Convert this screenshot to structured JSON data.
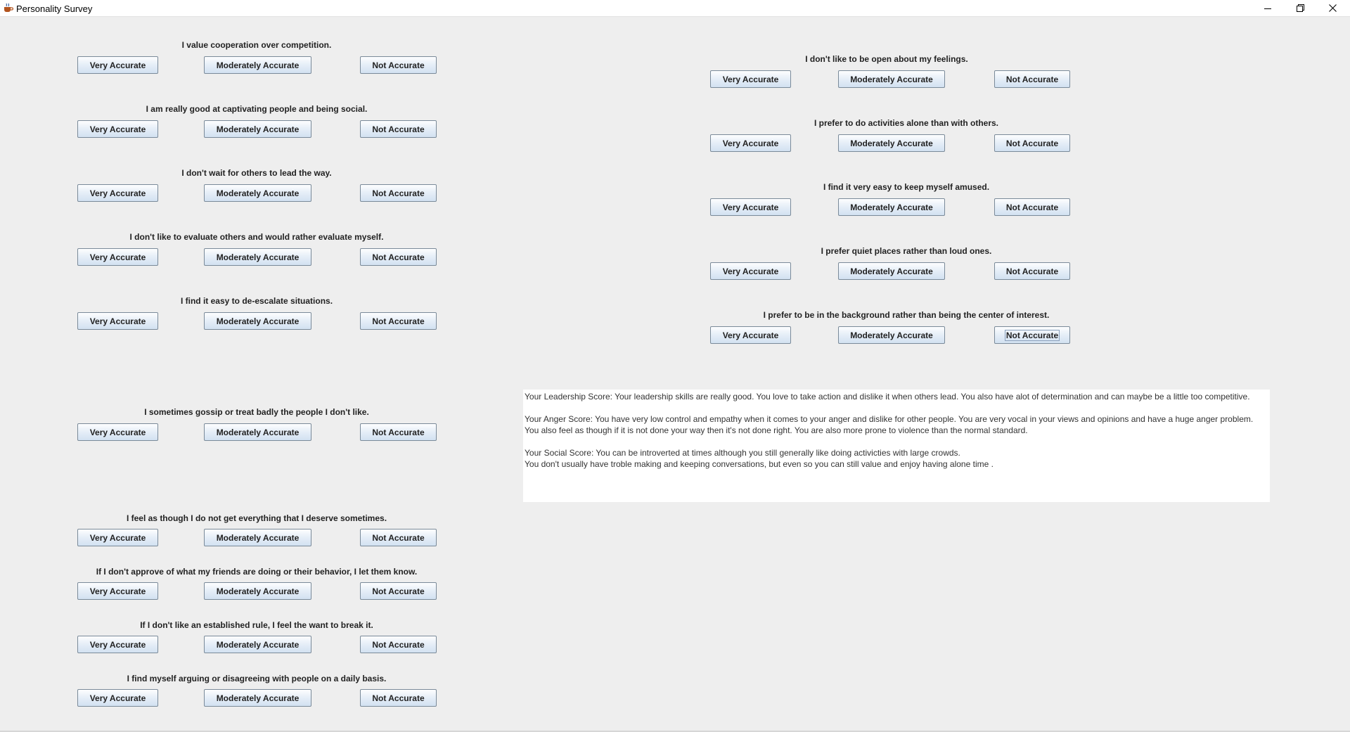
{
  "window": {
    "title": "Personality Survey",
    "icons": {
      "app": "java-cup-icon",
      "minimize": "minimize-icon",
      "restore": "restore-icon",
      "close": "close-icon"
    }
  },
  "answers": {
    "very": "Very Accurate",
    "moderate": "Moderately Accurate",
    "not": "Not Accurate"
  },
  "left_questions": [
    "I value cooperation over competition.",
    "I am really good at captivating people and being social.",
    "I don't wait for others to lead the way.",
    "I don't like to evaluate others and would rather evaluate myself.",
    "I find it easy to de-escalate situations.",
    "I sometimes gossip or treat badly the people I don't like.",
    "I feel as though I do not get everything that I deserve sometimes.",
    "If I don't approve of what my friends are doing or their behavior, I let them know.",
    "If I don't like an established rule, I feel the want to break it.",
    "I find myself arguing or disagreeing with people on a daily basis."
  ],
  "right_questions": [
    "I don't like to be open about my feelings.",
    "I prefer to do activities alone than with others.",
    "I find it very easy to keep myself amused.",
    "I prefer quiet places rather than loud ones.",
    "I prefer to be in the background rather than being the center of interest."
  ],
  "results": {
    "leadership": "Your Leadership Score: Your leadership skills are really good. You love to take action and dislike it when others lead. You also have alot of determination and can maybe be a little too competitive.",
    "anger_1": "Your Anger Score:  You have very low control and empathy when it comes to your anger and dislike for other people. You are very vocal in your views and opinions and have a huge anger problem.",
    "anger_2": "You also feel as though if it is not done your way then it's not done right. You are also more prone to violence than the normal standard.",
    "social_1": "Your Social Score: You can be introverted at times although you still generally like doing activicties with large crowds.",
    "social_2": "You don't usually have troble making and keeping conversations, but even so you can still value and enjoy having alone time  ."
  }
}
